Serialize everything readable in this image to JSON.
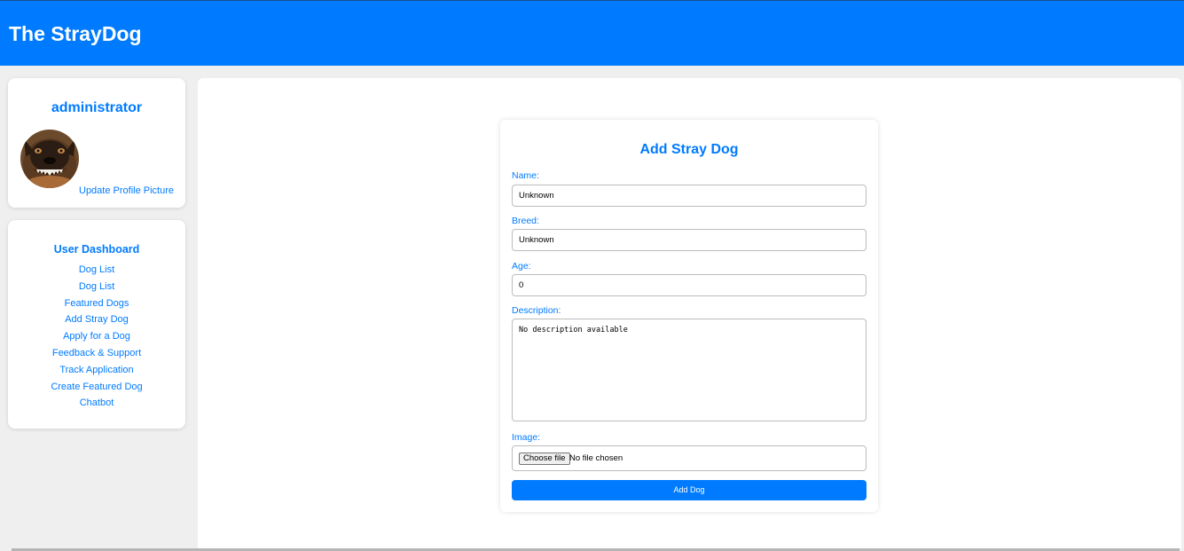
{
  "header": {
    "title": "The StrayDog"
  },
  "profile": {
    "username": "administrator",
    "avatar_icon": "dog-avatar-photo",
    "update_link": "Update Profile Picture"
  },
  "dashboard": {
    "title": "User Dashboard",
    "items": [
      "Dog List",
      "Dog List",
      "Featured Dogs",
      "Add Stray Dog",
      "Apply for a Dog",
      "Feedback & Support",
      "Track Application",
      "Create Featured Dog",
      "Chatbot"
    ]
  },
  "form": {
    "title": "Add Stray Dog",
    "name": {
      "label": "Name:",
      "value": "Unknown"
    },
    "breed": {
      "label": "Breed:",
      "value": "Unknown"
    },
    "age": {
      "label": "Age:",
      "value": "0"
    },
    "description": {
      "label": "Description:",
      "value": "No description available"
    },
    "image": {
      "label": "Image:",
      "button": "Choose file",
      "status": "No file chosen"
    },
    "submit": "Add Dog"
  },
  "colors": {
    "accent": "#007bff",
    "background": "#efefef",
    "card": "#ffffff"
  }
}
